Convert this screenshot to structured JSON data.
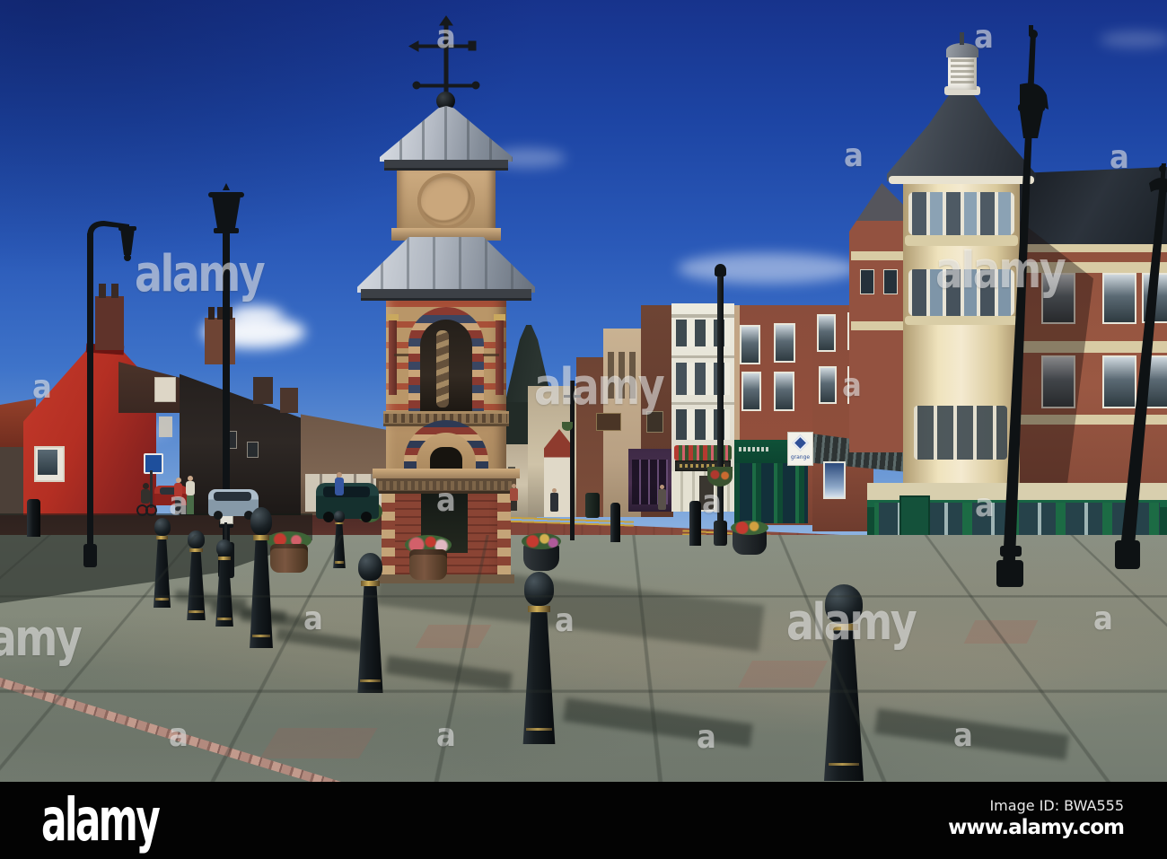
{
  "watermark": {
    "brand": "alamy",
    "letter": "a"
  },
  "footer": {
    "logo": "alamy",
    "image_id": "Image ID: BWA555",
    "website": "www.alamy.com"
  },
  "signs": {
    "grange_label": "grange"
  },
  "colors": {
    "sky_top": "#17338c",
    "sky_horizon": "#a4c4e9",
    "red_building": "#b92f24",
    "tower_sandstone": "#b6946b",
    "tower_brick_band": "#9e4a36",
    "tower_roof_metal": "#c3c9d2",
    "turret_cream": "#efe3bd",
    "turret_roof_slate": "#454b53",
    "right_brick": "#93523e",
    "stone_band": "#d8cba4",
    "green_shopfront": "#176443",
    "hotel_white": "#e9e7df",
    "road_red_brick": "#7c4136",
    "pavement_grey": "#828879",
    "cobble_strip_pink": "#b28a7e",
    "bollard_black": "#0d1114",
    "watermark_white_alpha": "rgba(255,255,255,0.52)",
    "footer_bar": "#030303"
  }
}
